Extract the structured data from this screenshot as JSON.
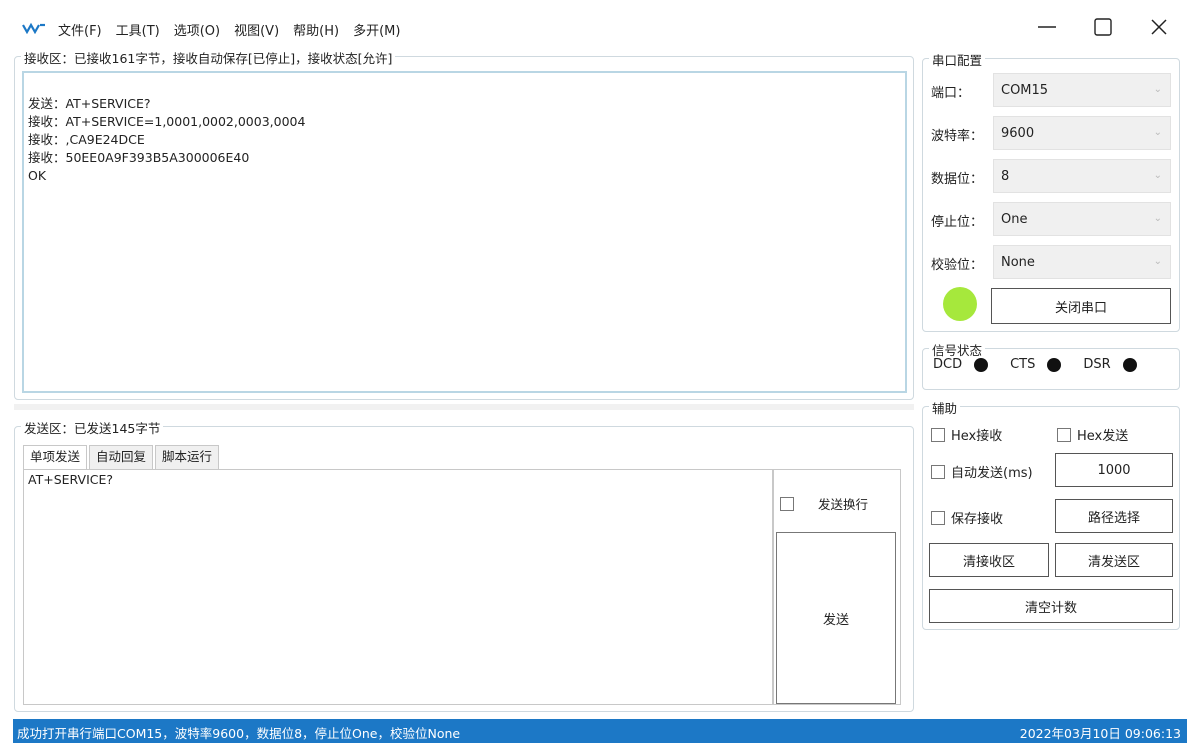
{
  "menu": {
    "items": [
      "文件(F)",
      "工具(T)",
      "选项(O)",
      "视图(V)",
      "帮助(H)",
      "多开(M)"
    ]
  },
  "window": {
    "minimize_icon": "minimize-icon",
    "maximize_icon": "maximize-icon",
    "close_icon": "close-icon"
  },
  "receive": {
    "title": "接收区：已接收161字节，接收自动保存[已停止]，接收状态[允许]",
    "lines": [
      "发送：AT+SERVICE?",
      "接收：AT+SERVICE=1,0001,0002,0003,0004",
      "接收：,CA9E24DCE",
      "接收：50EE0A9F393B5A300006E40",
      "OK"
    ]
  },
  "send": {
    "title": "发送区：已发送145字节",
    "tabs": [
      "单项发送",
      "自动回复",
      "脚本运行"
    ],
    "active_tab": 0,
    "input_value": "AT+SERVICE?",
    "newline_label": "发送换行",
    "send_label": "发送"
  },
  "serial_config": {
    "title": "串口配置",
    "fields": [
      {
        "label": "端口：",
        "value": "COM15"
      },
      {
        "label": "波特率：",
        "value": "9600"
      },
      {
        "label": "数据位：",
        "value": "8"
      },
      {
        "label": "停止位：",
        "value": "One"
      },
      {
        "label": "校验位：",
        "value": "None"
      }
    ],
    "close_port_label": "关闭串口",
    "status_led_color": "#a6e83c"
  },
  "signal": {
    "title": "信号状态",
    "items": [
      "DCD",
      "CTS",
      "DSR"
    ]
  },
  "aux": {
    "title": "辅助",
    "hex_recv": "Hex接收",
    "hex_send": "Hex发送",
    "auto_send": "自动发送(ms)",
    "auto_send_interval": "1000",
    "save_recv": "保存接收",
    "path_select": "路径选择",
    "clear_recv": "清接收区",
    "clear_send": "清发送区",
    "clear_count": "清空计数"
  },
  "status": {
    "message": "成功打开串行端口COM15，波特率9600，数据位8，停止位One，校验位None",
    "datetime": "2022年03月10日 09:06:13"
  },
  "colors": {
    "status_bar": "#1c78c6",
    "group_border": "#cfd9df"
  }
}
